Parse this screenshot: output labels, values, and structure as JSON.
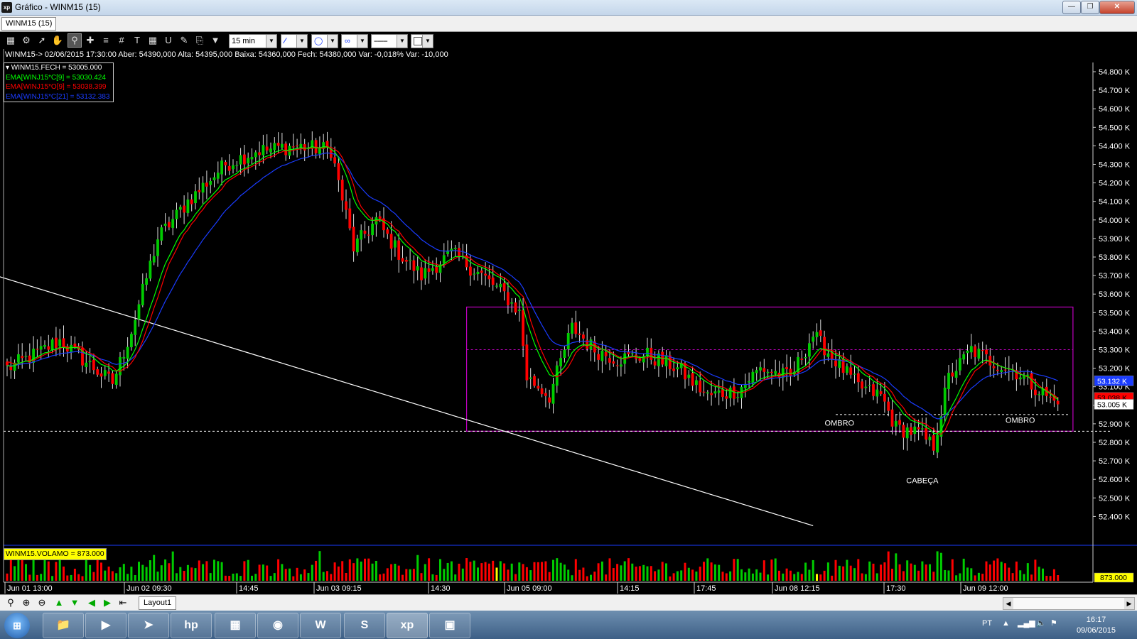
{
  "window": {
    "title": "Gráfico - WINM15 (15)",
    "app_icon": "xp"
  },
  "tab": {
    "label": "WINM15 (15)"
  },
  "toolbar": {
    "timeframe": "15 min"
  },
  "info_line": "WINM15-> 02/06/2015 17:30:00 Aber: 54390,000 Alta: 54395,000 Baixa: 54360,000 Fech: 54380,000 Var: -0,018% Var: -10,000",
  "legend": [
    {
      "text": "WINM15.FECH = 53005.000",
      "color": "#ffffff"
    },
    {
      "text": "EMA[WINJ15*C[9] = 53030.424",
      "color": "#00ff00"
    },
    {
      "text": "EMA[WINJ15*O[9] = 53038.399",
      "color": "#ff0000"
    },
    {
      "text": "EMA[WINJ15*C[21] = 53132.383",
      "color": "#1a3cff"
    }
  ],
  "volume_label": "WINM15.VOLAMO = 873.000",
  "volume_value": "873.000",
  "price_axis": [
    "54.800 K",
    "54.700 K",
    "54.600 K",
    "54.500 K",
    "54.400 K",
    "54.300 K",
    "54.200 K",
    "54.100 K",
    "54.000 K",
    "53.900 K",
    "53.800 K",
    "53.700 K",
    "53.600 K",
    "53.500 K",
    "53.400 K",
    "53.300 K",
    "53.200 K",
    "53.100 K",
    "53.000 K",
    "52.900 K",
    "52.800 K",
    "52.700 K",
    "52.600 K",
    "52.500 K",
    "52.400 K"
  ],
  "price_tags": [
    {
      "text": "53.132 K",
      "price": 53132,
      "bg": "#1a3cff",
      "fg": "#ffffff"
    },
    {
      "text": "53.038 K",
      "price": 53038,
      "bg": "#ff0000",
      "fg": "#000000"
    },
    {
      "text": "53.005 K",
      "price": 53005,
      "bg": "#ffffff",
      "fg": "#000000"
    }
  ],
  "time_axis": [
    "Jun 01 13:00",
    "Jun 02 09:30",
    "14:45",
    "Jun 03 09:15",
    "14:30",
    "Jun 05 09:00",
    "14:15",
    "17:45",
    "Jun 08 12:15",
    "17:30",
    "Jun 09 12:00"
  ],
  "annotations": [
    {
      "text": "OMBRO",
      "index": 221,
      "price": 52890
    },
    {
      "text": "CABEÇA",
      "index": 243,
      "price": 52580
    },
    {
      "text": "OMBRO",
      "index": 269,
      "price": 52905
    }
  ],
  "bottom": {
    "layout_tab": "Layout1"
  },
  "taskbar": {
    "lang": "PT",
    "time": "16:17",
    "date": "09/06/2015"
  },
  "colors": {
    "up": "#00cc00",
    "down": "#ff0000",
    "ema_fast": "#00ff00",
    "ema_open": "#ff0000",
    "ema_slow": "#1a3cff",
    "rect": "#c000c0"
  },
  "chart_data": {
    "type": "candlestick",
    "title": "",
    "y_range": [
      52300,
      54900
    ],
    "count": 280,
    "close_anchors": [
      [
        0,
        53200
      ],
      [
        8,
        53280
      ],
      [
        14,
        53350
      ],
      [
        20,
        53250
      ],
      [
        28,
        53120
      ],
      [
        33,
        53400
      ],
      [
        40,
        53900
      ],
      [
        48,
        54100
      ],
      [
        58,
        54300
      ],
      [
        66,
        54370
      ],
      [
        76,
        54400
      ],
      [
        86,
        54380
      ],
      [
        92,
        53850
      ],
      [
        98,
        54000
      ],
      [
        104,
        53820
      ],
      [
        110,
        53700
      ],
      [
        118,
        53820
      ],
      [
        126,
        53700
      ],
      [
        132,
        53600
      ],
      [
        136,
        53500
      ],
      [
        138,
        53150
      ],
      [
        144,
        53050
      ],
      [
        150,
        53420
      ],
      [
        156,
        53300
      ],
      [
        162,
        53250
      ],
      [
        170,
        53270
      ],
      [
        178,
        53200
      ],
      [
        186,
        53050
      ],
      [
        194,
        53080
      ],
      [
        200,
        53200
      ],
      [
        208,
        53150
      ],
      [
        214,
        53380
      ],
      [
        220,
        53240
      ],
      [
        226,
        53100
      ],
      [
        232,
        53050
      ],
      [
        236,
        52880
      ],
      [
        242,
        52850
      ],
      [
        246,
        52780
      ],
      [
        250,
        53150
      ],
      [
        256,
        53300
      ],
      [
        262,
        53230
      ],
      [
        268,
        53180
      ],
      [
        274,
        53080
      ],
      [
        279,
        53005
      ]
    ],
    "ema_fast_last": 53030.424,
    "ema_open_last": 53038.399,
    "ema_slow_last": 53132.383,
    "last_close": 53005,
    "lines": [
      {
        "kind": "trendline",
        "from": {
          "index": -3,
          "price": 53700
        },
        "to": {
          "index": 214,
          "price": 52350
        },
        "color": "#ffffff"
      },
      {
        "kind": "hline",
        "price": 52860,
        "color": "#ffffff",
        "dashed": true
      },
      {
        "kind": "hline",
        "price": 53300,
        "color": "#c000c0",
        "dashed": true,
        "from_index": 122,
        "to_index": 283
      },
      {
        "kind": "hline",
        "price": 52950,
        "color": "#ffffff",
        "dashed": true,
        "from_index": 220,
        "to_index": 282
      }
    ],
    "rectangle": {
      "from_index": 122,
      "to_index": 283,
      "top_price": 53530,
      "bottom_price": 52860,
      "color": "#c000c0"
    },
    "volume": {
      "last": 873,
      "highlight_indices": [
        130,
        215
      ]
    }
  }
}
